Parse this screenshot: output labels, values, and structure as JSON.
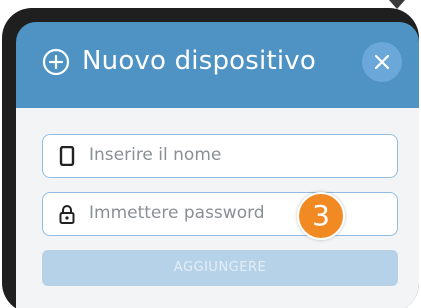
{
  "dialog": {
    "title": "Nuovo dispositivo",
    "title_icon": "plus-circle-icon",
    "close_icon": "close-icon",
    "header_color": "#4e93c4"
  },
  "form": {
    "name_field": {
      "placeholder": "Inserire il nome",
      "value": "",
      "icon": "phone-icon"
    },
    "password_field": {
      "placeholder": "Immettere password",
      "value": "",
      "icon": "lock-icon"
    },
    "submit_label": "AGGIUNGERE"
  },
  "annotation": {
    "step": "3",
    "color": "#f28a24"
  }
}
